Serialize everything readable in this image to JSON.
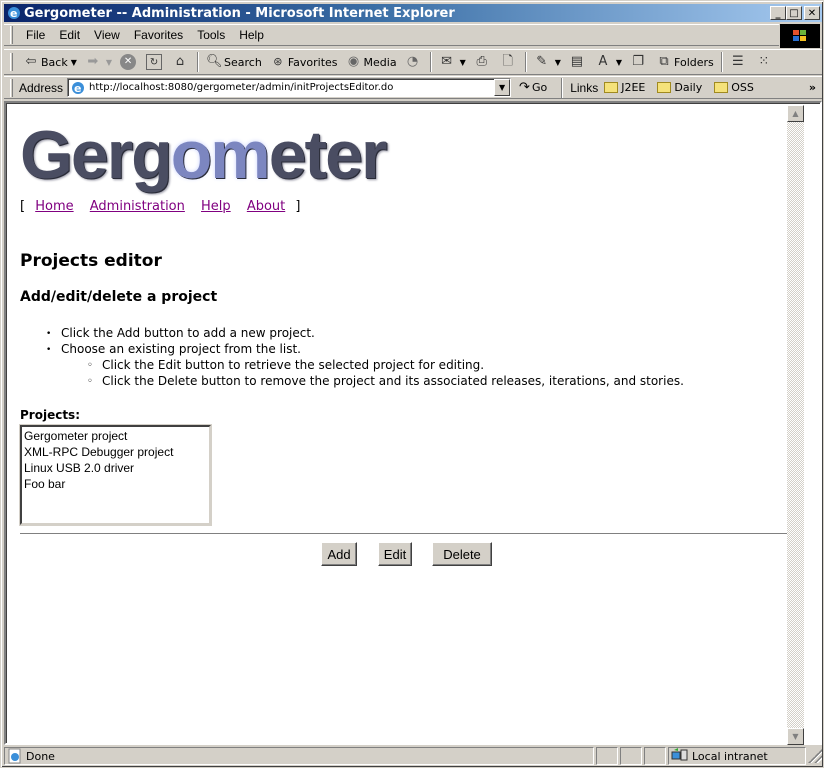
{
  "window": {
    "title": "Gergometer -- Administration - Microsoft Internet Explorer",
    "controls": {
      "minimize": "_",
      "maximize": "□",
      "close": "✕"
    }
  },
  "menubar": [
    "File",
    "Edit",
    "View",
    "Favorites",
    "Tools",
    "Help"
  ],
  "toolbar": {
    "back": "Back",
    "search": "Search",
    "favorites": "Favorites",
    "media": "Media",
    "folders": "Folders"
  },
  "addressbar": {
    "label": "Address",
    "url": "http://localhost:8080/gergometer/admin/initProjectsEditor.do",
    "go": "Go",
    "links_label": "Links",
    "links": [
      "J2EE",
      "Daily",
      "OSS"
    ],
    "more": "»"
  },
  "page": {
    "logo": {
      "part1": "Gerg",
      "highlight": "om",
      "part2": "eter"
    },
    "nav": {
      "open_bracket": "[",
      "close_bracket": "]",
      "links": [
        "Home",
        "Administration",
        "Help",
        "About"
      ]
    },
    "title": "Projects editor",
    "subtitle": "Add/edit/delete a project",
    "instructions": {
      "items": [
        "Click the Add button to add a new project.",
        "Choose an existing project from the list."
      ],
      "subitems": [
        "Click the Edit button to retrieve the selected project for editing.",
        "Click the Delete button to remove the project and its associated releases, iterations, and stories."
      ]
    },
    "projects_label": "Projects:",
    "projects": [
      "Gergometer project",
      "XML-RPC Debugger project",
      "Linux USB 2.0 driver",
      "Foo bar"
    ],
    "buttons": {
      "add": "Add",
      "edit": "Edit",
      "delete": "Delete"
    }
  },
  "statusbar": {
    "status": "Done",
    "zone": "Local intranet"
  }
}
